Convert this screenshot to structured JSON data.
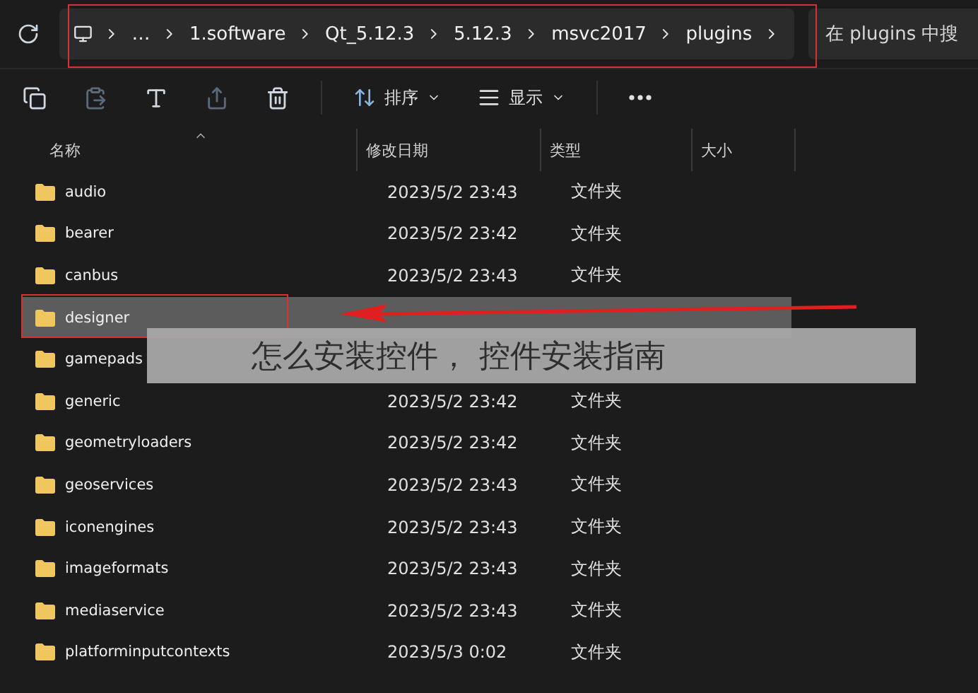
{
  "address_bar": {
    "crumbs": [
      "…",
      "1.software",
      "Qt_5.12.3",
      "5.12.3",
      "msvc2017",
      "plugins"
    ]
  },
  "search": {
    "placeholder": "在 plugins 中搜"
  },
  "toolbar": [
    {
      "kind": "copy",
      "disabled": false
    },
    {
      "kind": "paste",
      "disabled": true
    },
    {
      "kind": "rename",
      "disabled": false
    },
    {
      "kind": "share",
      "disabled": true
    },
    {
      "kind": "delete",
      "disabled": false
    },
    {
      "kind": "sort",
      "label": "排序"
    },
    {
      "kind": "view",
      "label": "显示"
    },
    {
      "kind": "more"
    }
  ],
  "columns": [
    "名称",
    "修改日期",
    "类型",
    "大小"
  ],
  "rows": [
    {
      "name": "audio",
      "date": "2023/5/2 23:43",
      "type": "文件夹",
      "selected": false
    },
    {
      "name": "bearer",
      "date": "2023/5/2 23:42",
      "type": "文件夹",
      "selected": false
    },
    {
      "name": "canbus",
      "date": "2023/5/2 23:43",
      "type": "文件夹",
      "selected": false
    },
    {
      "name": "designer",
      "selected": true
    },
    {
      "name": "gamepads",
      "selected": false
    },
    {
      "name": "generic",
      "date": "2023/5/2 23:42",
      "type": "文件夹",
      "selected": false
    },
    {
      "name": "geometryloaders",
      "date": "2023/5/2 23:42",
      "type": "文件夹",
      "selected": false
    },
    {
      "name": "geoservices",
      "date": "2023/5/2 23:43",
      "type": "文件夹",
      "selected": false
    },
    {
      "name": "iconengines",
      "date": "2023/5/2 23:43",
      "type": "文件夹",
      "selected": false
    },
    {
      "name": "imageformats",
      "date": "2023/5/2 23:43",
      "type": "文件夹",
      "selected": false
    },
    {
      "name": "mediaservice",
      "date": "2023/5/2 23:43",
      "type": "文件夹",
      "selected": false
    },
    {
      "name": "platforminputcontexts",
      "date": "2023/5/3 0:02",
      "type": "文件夹",
      "selected": false
    }
  ],
  "caption_banner": {
    "text": "怎么安装控件， 控件安装指南"
  }
}
